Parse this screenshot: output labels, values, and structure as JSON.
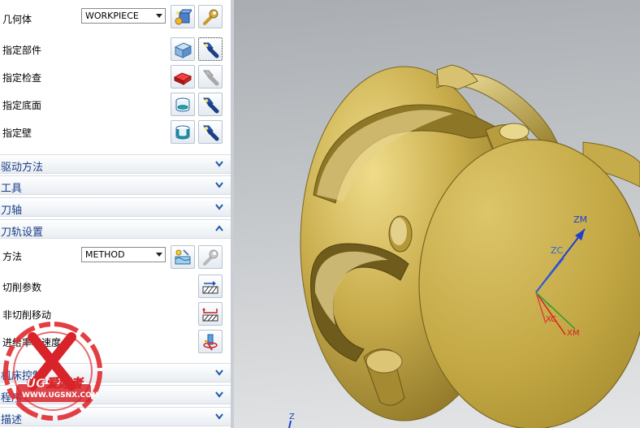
{
  "panel": {
    "geometry": {
      "label": "几何体",
      "combo_value": "WORKPIECE",
      "new_icon": "new-geometry-icon",
      "edit_icon": "wrench-edit-icon"
    },
    "rows": [
      {
        "label": "指定部件",
        "icon1": "select-part-icon",
        "icon2": "flashlight-display-icon"
      },
      {
        "label": "指定检查",
        "icon1": "select-check-icon",
        "icon2": "flashlight-disabled-icon"
      },
      {
        "label": "指定底面",
        "icon1": "select-floor-icon",
        "icon2": "flashlight-display-icon"
      },
      {
        "label": "指定壁",
        "icon1": "select-wall-icon",
        "icon2": "flashlight-display-icon"
      }
    ],
    "sections": {
      "drive_method": "驱动方法",
      "tool": "工具",
      "tool_axis": "刀轴",
      "path_settings": "刀轨设置",
      "machine_control": "机床控制",
      "program": "程序",
      "description": "描述"
    },
    "path_settings": {
      "method_label": "方法",
      "method_value": "METHOD",
      "cut_params_label": "切削参数",
      "non_cut_label": "非切削移动",
      "feeds_label": "进给率和速度"
    }
  },
  "viewport": {
    "axis_labels": {
      "zm": "ZM",
      "zc": "ZC",
      "xc": "XC",
      "xm": "XM",
      "z_bottom": "Z"
    },
    "part_color": "#c8ad4a"
  },
  "watermark": {
    "line1": "UG爱好者",
    "line2": "WWW.UGSNX.COM"
  }
}
